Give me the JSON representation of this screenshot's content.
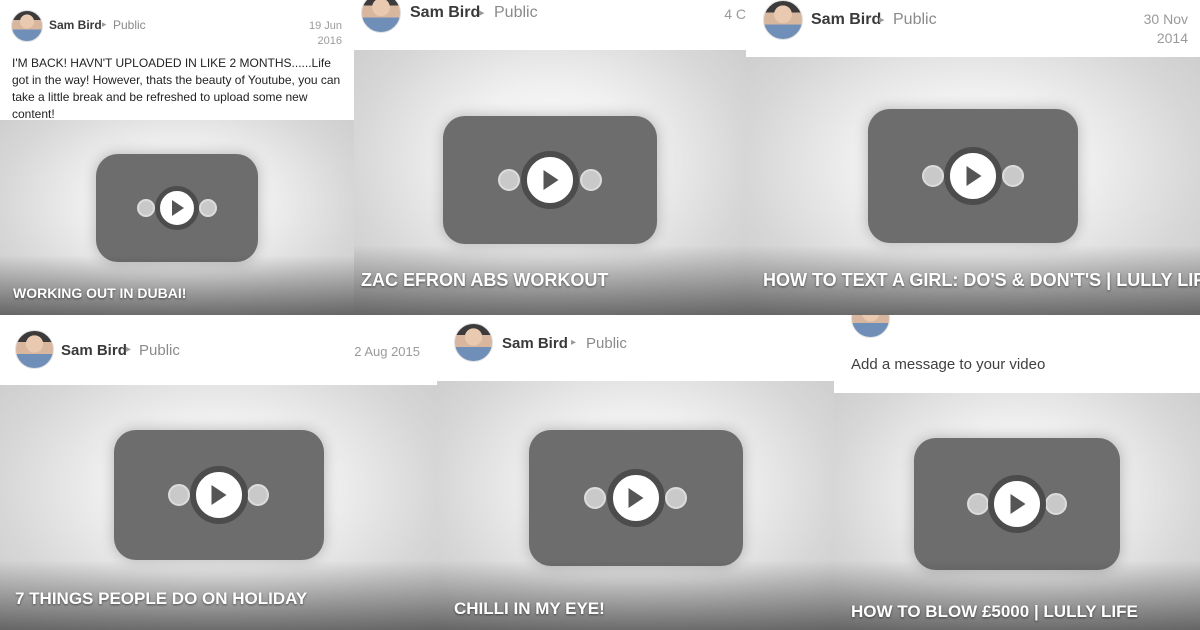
{
  "cards": [
    {
      "author": "Sam Bird",
      "separator": "▸",
      "visibility": "Public",
      "date": "19 Jun\n2016",
      "message": "I'M BACK! HAVN'T UPLOADED IN LIKE 2 MONTHS......Life got in the way! However, thats the beauty of Youtube, you can take a little break and be refreshed to upload some new content!",
      "video_title": "WORKING OUT IN DUBAI!"
    },
    {
      "author": "Sam Bird",
      "separator": "▸",
      "visibility": "Public",
      "date": "4 C",
      "video_title": "ZAC EFRON ABS WORKOUT"
    },
    {
      "author": "Sam Bird",
      "separator": "▸",
      "visibility": "Public",
      "date": "30 Nov\n2014",
      "video_title": "HOW TO TEXT A GIRL: DO'S & DON'T'S | LULLY LIFE"
    },
    {
      "author": "Sam Bird",
      "separator": "▸",
      "visibility": "Public",
      "date": "2 Aug 2015",
      "video_title": "7 THINGS PEOPLE DO ON HOLIDAY"
    },
    {
      "author": "Sam Bird",
      "separator": "▸",
      "visibility": "Public",
      "video_title": "CHILLI IN MY EYE!"
    },
    {
      "message_prompt": "Add a message to your video",
      "video_title": "HOW TO BLOW £5000 | LULLY LIFE"
    }
  ]
}
